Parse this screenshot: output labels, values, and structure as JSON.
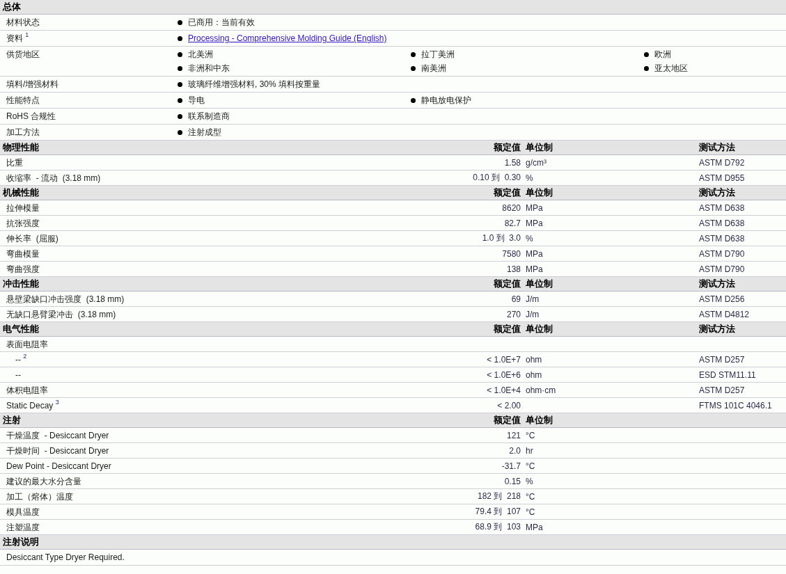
{
  "sections": [
    {
      "title": "总体",
      "kind": "general",
      "rows": [
        {
          "label": "材料状态",
          "items": [
            {
              "kind": "text",
              "text": "已商用：当前有效"
            }
          ]
        },
        {
          "label": "资料 $^{1}$",
          "items": [
            {
              "kind": "link",
              "text": "Processing - Comprehensive Molding Guide (English)"
            }
          ]
        },
        {
          "label": "供货地区",
          "items": [
            {
              "kind": "text",
              "text": "北美洲"
            },
            {
              "kind": "text",
              "text": "拉丁美洲"
            },
            {
              "kind": "text",
              "text": "欧洲"
            },
            {
              "kind": "text",
              "text": "非洲和中东"
            },
            {
              "kind": "text",
              "text": "南美洲"
            },
            {
              "kind": "text",
              "text": "亚太地区"
            }
          ]
        },
        {
          "label": "填料/增强材料",
          "items": [
            {
              "kind": "text",
              "text": "玻璃纤维增强材料, 30% 填料按重量"
            }
          ]
        },
        {
          "label": "性能特点",
          "items": [
            {
              "kind": "text",
              "text": "导电"
            },
            {
              "kind": "text",
              "text": "静电放电保护"
            }
          ]
        },
        {
          "label": "RoHS 合规性",
          "items": [
            {
              "kind": "text",
              "text": "联系制造商"
            }
          ]
        },
        {
          "label": "加工方法",
          "items": [
            {
              "kind": "text",
              "text": "注射成型"
            }
          ]
        }
      ]
    },
    {
      "title": "物理性能",
      "kind": "properties",
      "columns": [
        "额定值",
        "单位制",
        "测试方法"
      ],
      "rows": [
        {
          "label": "比重",
          "value": "1.58",
          "unit": "g/cm³",
          "test": "ASTM D792"
        },
        {
          "label": "收缩率  - 流动  (3.18 mm)",
          "value": "0.10 到  0.30",
          "unit": "%",
          "test": "ASTM D955"
        }
      ]
    },
    {
      "title": "机械性能",
      "kind": "properties",
      "columns": [
        "额定值",
        "单位制",
        "测试方法"
      ],
      "rows": [
        {
          "label": "拉伸模量",
          "value": "8620",
          "unit": "MPa",
          "test": "ASTM D638"
        },
        {
          "label": "抗张强度",
          "value": "82.7",
          "unit": "MPa",
          "test": "ASTM D638"
        },
        {
          "label": "伸长率  (屈服)",
          "value": "1.0 到  3.0",
          "unit": "%",
          "test": "ASTM D638"
        },
        {
          "label": "弯曲模量",
          "value": "7580",
          "unit": "MPa",
          "test": "ASTM D790"
        },
        {
          "label": "弯曲强度",
          "value": "138",
          "unit": "MPa",
          "test": "ASTM D790"
        }
      ]
    },
    {
      "title": "冲击性能",
      "kind": "properties",
      "columns": [
        "额定值",
        "单位制",
        "测试方法"
      ],
      "rows": [
        {
          "label": "悬壁梁缺口冲击强度  (3.18 mm)",
          "value": "69",
          "unit": "J/m",
          "test": "ASTM D256"
        },
        {
          "label": "无缺口悬臂梁冲击  (3.18 mm)",
          "value": "270",
          "unit": "J/m",
          "test": "ASTM D4812"
        }
      ]
    },
    {
      "title": "电气性能",
      "kind": "properties",
      "columns": [
        "额定值",
        "单位制",
        "测试方法"
      ],
      "rows": [
        {
          "label": "表面电阻率",
          "children": [
            {
              "label": "-- $^{2}$",
              "value": "< 1.0E+7",
              "unit": "ohm",
              "test": "ASTM D257"
            },
            {
              "label": "--",
              "value": "< 1.0E+6",
              "unit": "ohm",
              "test": "ESD STM11.11"
            }
          ]
        },
        {
          "label": "体积电阻率",
          "value": "< 1.0E+4",
          "unit": "ohm·cm",
          "test": "ASTM D257"
        },
        {
          "label": "Static Decay $^{3}$",
          "value": "< 2.00",
          "test": "FTMS 101C 4046.1"
        }
      ]
    },
    {
      "title": "注射",
      "kind": "properties",
      "columns": [
        "额定值",
        "单位制"
      ],
      "rows": [
        {
          "label": "干燥温度  - Desiccant Dryer",
          "value": "121",
          "unit": "°C"
        },
        {
          "label": "干燥时间  - Desiccant Dryer",
          "value": "2.0",
          "unit": "hr"
        },
        {
          "label": "Dew Point - Desiccant Dryer",
          "value": "-31.7",
          "unit": "°C"
        },
        {
          "label": "建议的最大水分含量",
          "value": "0.15",
          "unit": "%"
        },
        {
          "label": "加工（熔体）温度",
          "value": "182 到  218",
          "unit": "°C"
        },
        {
          "label": "模具温度",
          "value": "79.4 到  107",
          "unit": "°C"
        },
        {
          "label": "注塑温度",
          "value": "68.9 到  103",
          "unit": "MPa"
        }
      ]
    },
    {
      "title": "注射说明",
      "kind": "notes",
      "rows": [
        "Desiccant Type Dryer Required."
      ]
    }
  ]
}
